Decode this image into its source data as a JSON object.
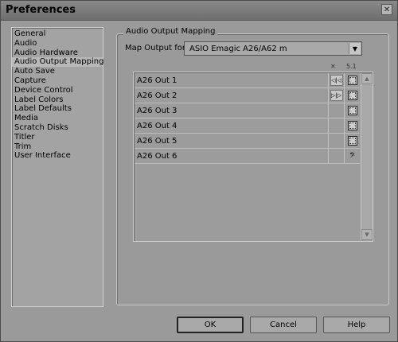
{
  "window": {
    "title": "Preferences",
    "close_glyph": "✕"
  },
  "sidebar": {
    "items": [
      {
        "label": "General"
      },
      {
        "label": "Audio"
      },
      {
        "label": "Audio Hardware"
      },
      {
        "label": "Audio Output Mapping",
        "selected": true
      },
      {
        "label": "Auto Save"
      },
      {
        "label": "Capture"
      },
      {
        "label": "Device Control"
      },
      {
        "label": "Label Colors"
      },
      {
        "label": "Label Defaults"
      },
      {
        "label": "Media"
      },
      {
        "label": "Scratch Disks"
      },
      {
        "label": "Titler"
      },
      {
        "label": "Trim"
      },
      {
        "label": "User Interface"
      }
    ]
  },
  "group": {
    "legend": "Audio Output Mapping"
  },
  "map_output": {
    "label": "Map Output for:",
    "value": "ASIO Emagic A26/A62 m",
    "arrow": "▼"
  },
  "columns": {
    "stereo_head": "✕",
    "surround_head": "5.1"
  },
  "outputs": [
    {
      "label": "A26 Out 1",
      "stereo_icon": "speaker-left-icon",
      "surround_icon": "surround-front-left-icon"
    },
    {
      "label": "A26 Out 2",
      "stereo_icon": "speaker-right-icon",
      "surround_icon": "surround-front-right-icon"
    },
    {
      "label": "A26 Out 3",
      "surround_icon": "surround-rear-left-icon"
    },
    {
      "label": "A26 Out 4",
      "surround_icon": "surround-rear-right-icon"
    },
    {
      "label": "A26 Out 5",
      "surround_icon": "surround-center-icon"
    },
    {
      "label": "A26 Out 6",
      "surround_icon": "subwoofer-icon",
      "surround_glyph": "𝄢"
    }
  ],
  "scrollbar": {
    "up": "▲",
    "down": "▼"
  },
  "buttons": {
    "ok": "OK",
    "cancel": "Cancel",
    "help": "Help"
  },
  "colors": {
    "background": "#9a9a9a",
    "titlebar": "#7c7c7c"
  }
}
